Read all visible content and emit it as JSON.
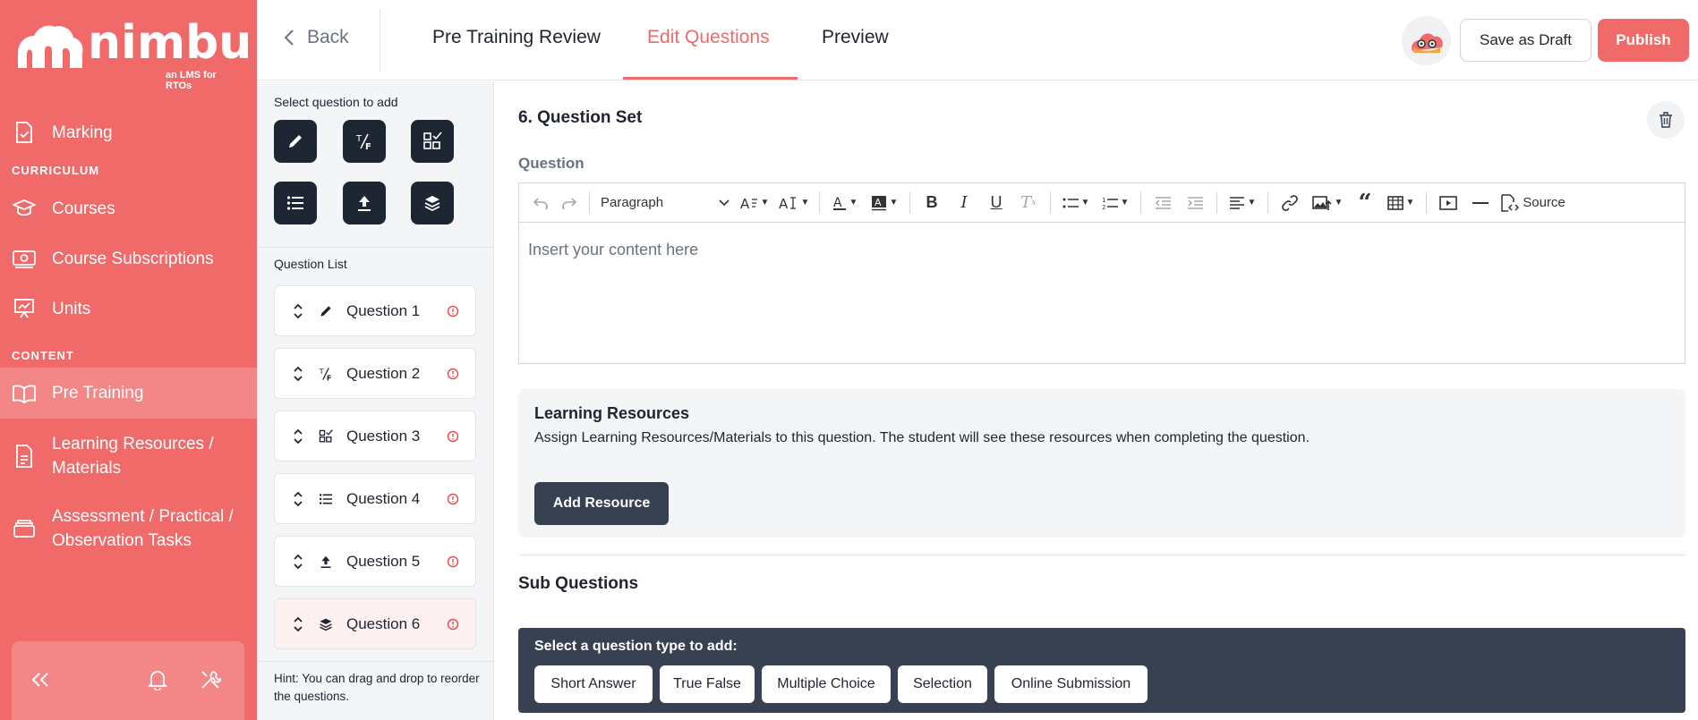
{
  "brand": {
    "name": "nimbu",
    "tagline": "an LMS for RTOs",
    "accent": "#f06a6a",
    "dark": "#1f2633"
  },
  "sidebar": {
    "items": [
      {
        "label": "Marking",
        "icon": "document-check-icon"
      },
      {
        "label": "Courses",
        "icon": "graduation-cap-icon"
      },
      {
        "label": "Course Subscriptions",
        "icon": "money-icon"
      },
      {
        "label": "Units",
        "icon": "presentation-board-icon"
      },
      {
        "label": "Pre Training",
        "icon": "open-book-icon"
      },
      {
        "label": "Learning Resources / Materials",
        "icon": "document-icon"
      },
      {
        "label": "Assessment / Practical / Observation Tasks",
        "icon": "stack-icon"
      }
    ],
    "sections": {
      "curriculum": "CURRICULUM",
      "content": "CONTENT"
    },
    "active": "Pre Training"
  },
  "header": {
    "back_label": "Back",
    "tabs": [
      {
        "label": "Pre Training Review"
      },
      {
        "label": "Edit Questions"
      },
      {
        "label": "Preview"
      }
    ],
    "active_tab": "Edit Questions",
    "save_draft": "Save as Draft",
    "publish": "Publish"
  },
  "question_panel": {
    "select_label": "Select question to add",
    "list_label": "Question List",
    "questions": [
      {
        "label": "Question 1",
        "icon": "pencil-icon"
      },
      {
        "label": "Question 2",
        "icon": "true-false-icon"
      },
      {
        "label": "Question 3",
        "icon": "multiple-choice-icon"
      },
      {
        "label": "Question 4",
        "icon": "list-icon"
      },
      {
        "label": "Question 5",
        "icon": "upload-icon"
      },
      {
        "label": "Question 6",
        "icon": "layers-icon"
      }
    ],
    "active_question": "Question 6",
    "hint": "Hint: You can drag and drop to reorder the questions."
  },
  "editor": {
    "set_title": "6. Question Set",
    "question_label": "Question",
    "paragraph_select": "Paragraph",
    "source_label": "Source",
    "placeholder": "Insert your content here"
  },
  "resources": {
    "title": "Learning Resources",
    "description": "Assign Learning Resources/Materials to this question. The student will see these resources when completing the question.",
    "add_button": "Add Resource"
  },
  "sub_questions": {
    "title": "Sub Questions",
    "prompt": "Select a question type to add:",
    "types": [
      "Short Answer",
      "True False",
      "Multiple Choice",
      "Selection",
      "Online Submission"
    ]
  }
}
